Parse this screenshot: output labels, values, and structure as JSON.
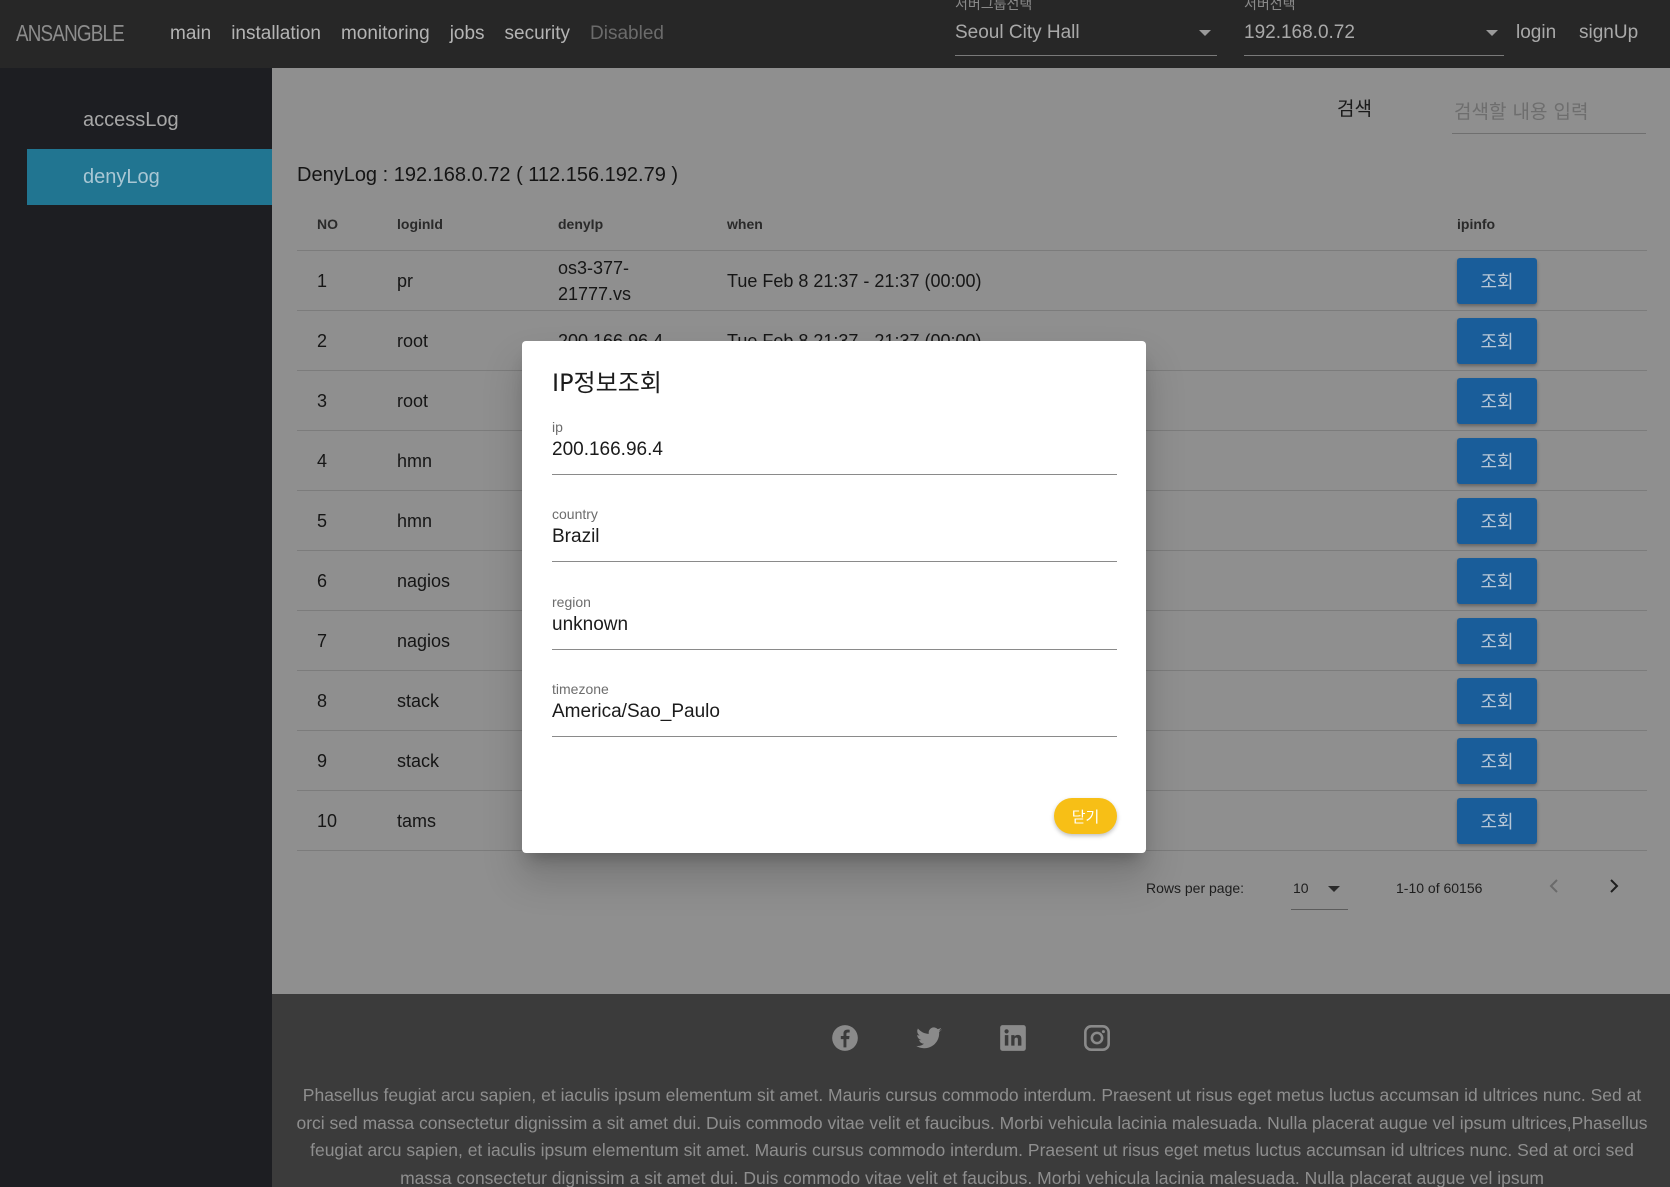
{
  "appbar": {
    "logo": "ANSANGBLE",
    "nav": [
      "main",
      "installation",
      "monitoring",
      "jobs",
      "security",
      "Disabled"
    ],
    "group_select": {
      "label": "서버그룹선택",
      "value": "Seoul City Hall"
    },
    "server_select": {
      "label": "서버선택",
      "value": "192.168.0.72"
    },
    "login": "login",
    "signup": "signUp"
  },
  "sidebar": {
    "items": [
      {
        "label": "accessLog"
      },
      {
        "label": "denyLog"
      }
    ]
  },
  "main": {
    "search_label": "검색",
    "search_placeholder": "검색할 내용 입력",
    "heading": "DenyLog : 192.168.0.72 ( 112.156.192.79 )"
  },
  "table": {
    "columns": [
      "NO",
      "loginId",
      "denyIp",
      "when",
      "ipinfo"
    ],
    "lookup_label": "조회",
    "rows": [
      {
        "no": "1",
        "login": "pr",
        "deny": "os3-377-21777.vs",
        "when": "Tue Feb 8 21:37 - 21:37 (00:00)"
      },
      {
        "no": "2",
        "login": "root",
        "deny": "200.166.96.4",
        "when": "Tue Feb 8 21:37 - 21:37 (00:00)"
      },
      {
        "no": "3",
        "login": "root",
        "deny": "",
        "when": ""
      },
      {
        "no": "4",
        "login": "hmn",
        "deny": "",
        "when": ""
      },
      {
        "no": "5",
        "login": "hmn",
        "deny": "",
        "when": ""
      },
      {
        "no": "6",
        "login": "nagios",
        "deny": "",
        "when": ""
      },
      {
        "no": "7",
        "login": "nagios",
        "deny": "",
        "when": ""
      },
      {
        "no": "8",
        "login": "stack",
        "deny": "",
        "when": ""
      },
      {
        "no": "9",
        "login": "stack",
        "deny": "",
        "when": ""
      },
      {
        "no": "10",
        "login": "tams",
        "deny": "",
        "when": ""
      }
    ]
  },
  "pagination": {
    "rows_per_page_label": "Rows per page:",
    "rows_per_page": "10",
    "range": "1-10 of 60156"
  },
  "footer": {
    "social_icons": [
      "facebook-icon",
      "twitter-icon",
      "linkedin-icon",
      "instagram-icon"
    ],
    "text": "Phasellus feugiat arcu sapien, et iaculis ipsum elementum sit amet. Mauris cursus commodo interdum. Praesent ut risus eget metus luctus accumsan id ultrices nunc. Sed at orci sed massa consectetur dignissim a sit amet dui. Duis commodo vitae velit et faucibus. Morbi vehicula lacinia malesuada. Nulla placerat augue vel ipsum ultrices,Phasellus feugiat arcu sapien, et iaculis ipsum elementum sit amet. Mauris cursus commodo interdum. Praesent ut risus eget metus luctus accumsan id ultrices nunc. Sed at orci sed massa consectetur dignissim a sit amet dui. Duis commodo vitae velit et faucibus. Morbi vehicula lacinia malesuada. Nulla placerat augue vel ipsum"
  },
  "dialog": {
    "title": "IP정보조회",
    "fields": [
      {
        "label": "ip",
        "value": "200.166.96.4"
      },
      {
        "label": "country",
        "value": "Brazil"
      },
      {
        "label": "region",
        "value": "unknown"
      },
      {
        "label": "timezone",
        "value": "America/Sao_Paulo"
      }
    ],
    "close_label": "닫기"
  },
  "colors": {
    "appbar": "#272727",
    "sidebar": "#1d1e22",
    "sidebar_active": "#217591",
    "content_dimmed": "#8f8f8f",
    "lookup_button": "#195d9a",
    "close_button": "#f7bf16",
    "footer": "#3b3b3b"
  }
}
